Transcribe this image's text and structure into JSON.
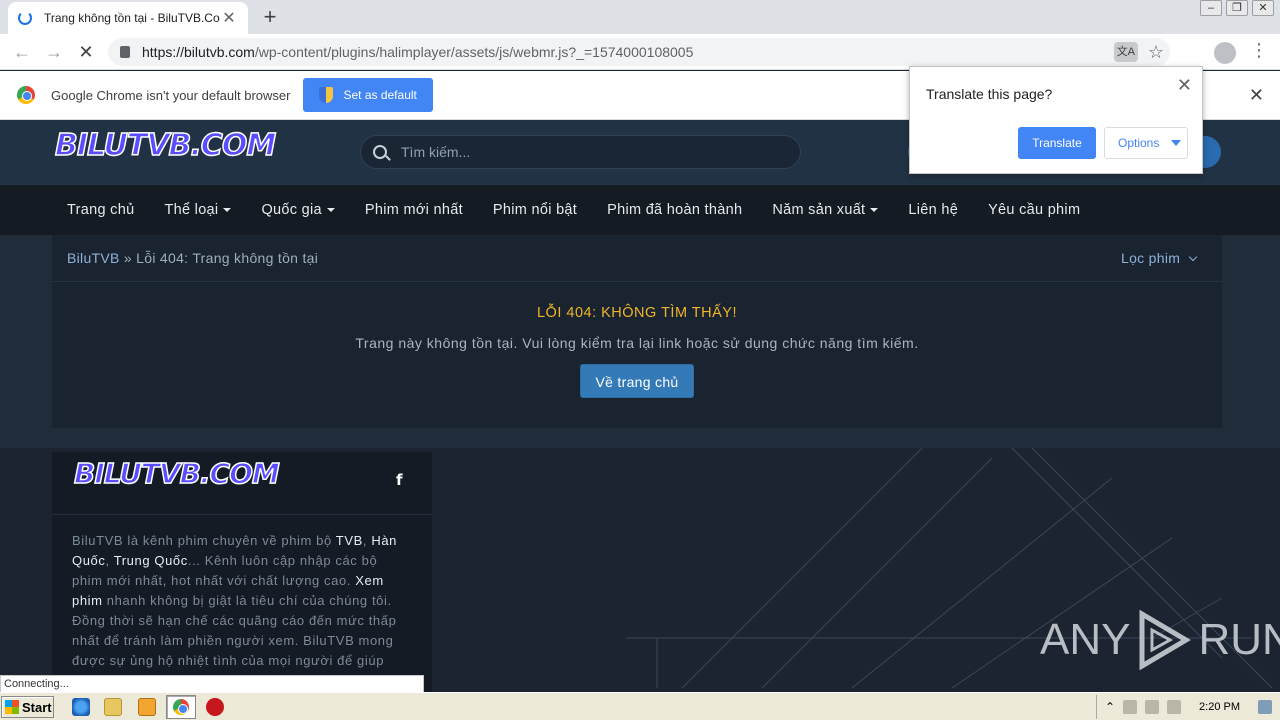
{
  "browser": {
    "tab_title": "Trang không tồn tại - BiluTVB.Com",
    "url_host": "https://bilutvb.com",
    "url_path": "/wp-content/plugins/halimplayer/assets/js/webmr.js?_=1574000108005",
    "status_text": "Connecting..."
  },
  "infobar": {
    "message": "Google Chrome isn't your default browser",
    "button_label": "Set as default"
  },
  "translate_popup": {
    "title": "Translate this page?",
    "translate_label": "Translate",
    "options_label": "Options"
  },
  "site": {
    "logo_text": "BILUTVB.COM",
    "search_placeholder": "Tìm kiếm...",
    "nav": [
      {
        "label": "Trang chủ"
      },
      {
        "label": "Thể loại"
      },
      {
        "label": "Quốc gia"
      },
      {
        "label": "Phim mới nhất"
      },
      {
        "label": "Phim nổi bật"
      },
      {
        "label": "Phim đã hoàn thành"
      },
      {
        "label": "Năm sản xuất"
      },
      {
        "label": "Liên hệ"
      },
      {
        "label": "Yêu cầu phim"
      }
    ],
    "breadcrumb_home": "BiluTVB",
    "breadcrumb_sep": " » ",
    "breadcrumb_current": "Lỗi 404: Trang không tồn tại",
    "filter_label": "Lọc phim",
    "error_title": "LỖI 404: KHÔNG TÌM THẤY!",
    "error_message": "Trang này không tồn tại. Vui lòng kiểm tra lại link hoặc sử dụng chức năng tìm kiếm.",
    "home_button": "Về trang chủ"
  },
  "footer": {
    "about": {
      "t1": "BiluTVB là kênh phim chuyên về phim bộ ",
      "h1": "TVB",
      "t2": ", ",
      "h2": "Hàn Quốc",
      "t3": ", ",
      "h3": "Trung Quốc",
      "t4": "... Kênh luôn cập nhập các bộ phim mới nhất, hot nhất với chất lượng cao. ",
      "h4": "Xem phim",
      "t5": " nhanh không bị giật là tiêu chí của chúng tôi. Đồng thời sẽ hạn chế các quãng cáo đến mức thấp nhất để tránh làm phiền người xem. BiluTVB mong được sự ủng hộ nhiệt tình của mọi người để giúp"
    }
  },
  "watermark": {
    "left": "ANY",
    "right": "RUN"
  },
  "taskbar": {
    "start_label": "Start",
    "clock": "2:20 PM"
  },
  "colors": {
    "accent_yellow": "#f0b429",
    "button_blue": "#337ab7",
    "chrome_blue": "#4285f4"
  }
}
